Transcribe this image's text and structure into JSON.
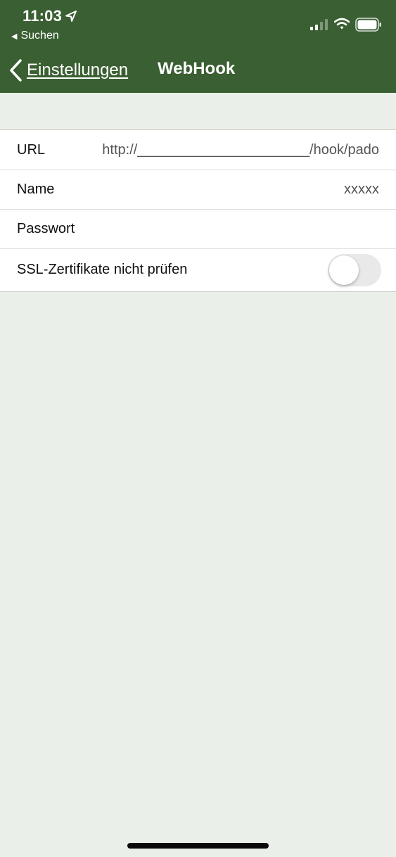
{
  "status_bar": {
    "time": "11:03",
    "back_app_label": "Suchen",
    "icons": [
      "location-arrow-icon",
      "signal-icon",
      "wifi-icon",
      "battery-icon"
    ]
  },
  "nav": {
    "back_label": "Einstellungen",
    "title": "WebHook"
  },
  "settings": {
    "url": {
      "label": "URL",
      "value": "http://______________________/hook/pado"
    },
    "name": {
      "label": "Name",
      "value": "xxxxx"
    },
    "password": {
      "label": "Passwort",
      "value": ""
    },
    "ssl": {
      "label": "SSL-Zertifikate nicht prüfen",
      "enabled": false
    }
  },
  "colors": {
    "header": "#3a5f32",
    "background": "#ebefe9",
    "toggle_off": "#e9e9ea"
  }
}
